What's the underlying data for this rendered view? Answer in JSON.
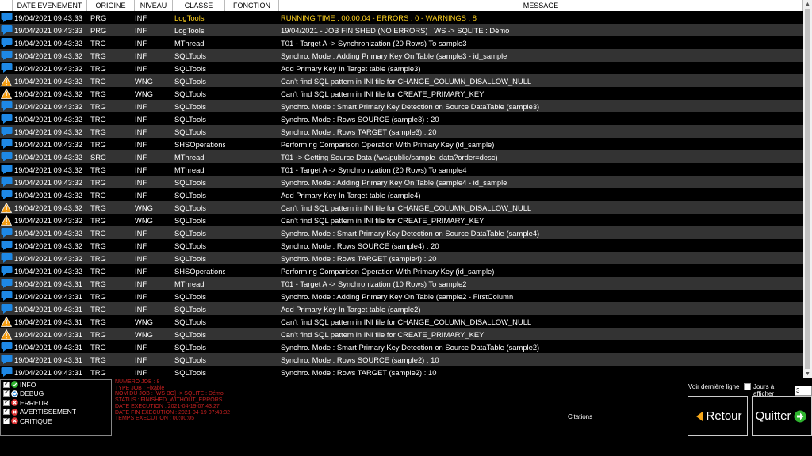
{
  "grid": {
    "columns": [
      "",
      "DATE EVENEMENT",
      "ORIGINE",
      "NIVEAU",
      "CLASSE",
      "FONCTION",
      "MESSAGE"
    ],
    "rows": [
      {
        "icon": "info-bubble-icon",
        "date": "19/04/2021 09:43:33",
        "origine": "PRG",
        "niveau": "INF",
        "classe": "LogTools",
        "fonction": "",
        "message": "RUNNING TIME : 00:00:04 - ERRORS : 0 - WARNINGS : 8",
        "highlight": true
      },
      {
        "icon": "info-bubble-icon",
        "date": "19/04/2021 09:43:33",
        "origine": "PRG",
        "niveau": "INF",
        "classe": "LogTools",
        "fonction": "",
        "message": "19/04/2021 - JOB FINISHED (NO ERRORS) : WS -> SQLITE : Démo"
      },
      {
        "icon": "info-bubble-icon",
        "date": "19/04/2021 09:43:32",
        "origine": "TRG",
        "niveau": "INF",
        "classe": "MThread",
        "fonction": "",
        "message": "T01 - Target A -> Synchronization (20 Rows) To sample3"
      },
      {
        "icon": "info-bubble-icon",
        "date": "19/04/2021 09:43:32",
        "origine": "TRG",
        "niveau": "INF",
        "classe": "SQLTools",
        "fonction": "",
        "message": "Synchro. Mode : Adding Primary Key On Table (sample3 - id_sample"
      },
      {
        "icon": "info-bubble-icon",
        "date": "19/04/2021 09:43:32",
        "origine": "TRG",
        "niveau": "INF",
        "classe": "SQLTools",
        "fonction": "",
        "message": "Add Primary Key In Target table (sample3)"
      },
      {
        "icon": "warning-icon",
        "date": "19/04/2021 09:43:32",
        "origine": "TRG",
        "niveau": "WNG",
        "classe": "SQLTools",
        "fonction": "",
        "message": "Can't find SQL pattern in INI file for CHANGE_COLUMN_DISALLOW_NULL"
      },
      {
        "icon": "warning-icon",
        "date": "19/04/2021 09:43:32",
        "origine": "TRG",
        "niveau": "WNG",
        "classe": "SQLTools",
        "fonction": "",
        "message": "Can't find SQL pattern in INI file for CREATE_PRIMARY_KEY"
      },
      {
        "icon": "info-bubble-icon",
        "date": "19/04/2021 09:43:32",
        "origine": "TRG",
        "niveau": "INF",
        "classe": "SQLTools",
        "fonction": "",
        "message": "Synchro. Mode : Smart Primary Key Detection on Source DataTable  (sample3)"
      },
      {
        "icon": "info-bubble-icon",
        "date": "19/04/2021 09:43:32",
        "origine": "TRG",
        "niveau": "INF",
        "classe": "SQLTools",
        "fonction": "",
        "message": "Synchro. Mode : Rows SOURCE  (sample3) : 20"
      },
      {
        "icon": "info-bubble-icon",
        "date": "19/04/2021 09:43:32",
        "origine": "TRG",
        "niveau": "INF",
        "classe": "SQLTools",
        "fonction": "",
        "message": "Synchro. Mode : Rows TARGET  (sample3) : 20"
      },
      {
        "icon": "info-bubble-icon",
        "date": "19/04/2021 09:43:32",
        "origine": "TRG",
        "niveau": "INF",
        "classe": "SHSOperations",
        "fonction": "",
        "message": "Performing Comparison Operation With Primary Key (id_sample)"
      },
      {
        "icon": "info-bubble-icon",
        "date": "19/04/2021 09:43:32",
        "origine": "SRC",
        "niveau": "INF",
        "classe": "MThread",
        "fonction": "",
        "message": "T01 -> Getting Source Data (/ws/public/sample_data?order=desc)"
      },
      {
        "icon": "info-bubble-icon",
        "date": "19/04/2021 09:43:32",
        "origine": "TRG",
        "niveau": "INF",
        "classe": "MThread",
        "fonction": "",
        "message": "T01 - Target A -> Synchronization (20 Rows) To sample4"
      },
      {
        "icon": "info-bubble-icon",
        "date": "19/04/2021 09:43:32",
        "origine": "TRG",
        "niveau": "INF",
        "classe": "SQLTools",
        "fonction": "",
        "message": "Synchro. Mode : Adding Primary Key On Table (sample4 - id_sample"
      },
      {
        "icon": "info-bubble-icon",
        "date": "19/04/2021 09:43:32",
        "origine": "TRG",
        "niveau": "INF",
        "classe": "SQLTools",
        "fonction": "",
        "message": "Add Primary Key In Target table (sample4)"
      },
      {
        "icon": "warning-icon",
        "date": "19/04/2021 09:43:32",
        "origine": "TRG",
        "niveau": "WNG",
        "classe": "SQLTools",
        "fonction": "",
        "message": "Can't find SQL pattern in INI file for CHANGE_COLUMN_DISALLOW_NULL"
      },
      {
        "icon": "warning-icon",
        "date": "19/04/2021 09:43:32",
        "origine": "TRG",
        "niveau": "WNG",
        "classe": "SQLTools",
        "fonction": "",
        "message": "Can't find SQL pattern in INI file for CREATE_PRIMARY_KEY"
      },
      {
        "icon": "info-bubble-icon",
        "date": "19/04/2021 09:43:32",
        "origine": "TRG",
        "niveau": "INF",
        "classe": "SQLTools",
        "fonction": "",
        "message": "Synchro. Mode : Smart Primary Key Detection on Source DataTable  (sample4)"
      },
      {
        "icon": "info-bubble-icon",
        "date": "19/04/2021 09:43:32",
        "origine": "TRG",
        "niveau": "INF",
        "classe": "SQLTools",
        "fonction": "",
        "message": "Synchro. Mode : Rows SOURCE  (sample4) : 20"
      },
      {
        "icon": "info-bubble-icon",
        "date": "19/04/2021 09:43:32",
        "origine": "TRG",
        "niveau": "INF",
        "classe": "SQLTools",
        "fonction": "",
        "message": "Synchro. Mode : Rows TARGET  (sample4) : 20"
      },
      {
        "icon": "info-bubble-icon",
        "date": "19/04/2021 09:43:32",
        "origine": "TRG",
        "niveau": "INF",
        "classe": "SHSOperations",
        "fonction": "",
        "message": "Performing Comparison Operation With Primary Key (id_sample)"
      },
      {
        "icon": "info-bubble-icon",
        "date": "19/04/2021 09:43:31",
        "origine": "TRG",
        "niveau": "INF",
        "classe": "MThread",
        "fonction": "",
        "message": "T01 - Target A -> Synchronization (10 Rows) To sample2"
      },
      {
        "icon": "info-bubble-icon",
        "date": "19/04/2021 09:43:31",
        "origine": "TRG",
        "niveau": "INF",
        "classe": "SQLTools",
        "fonction": "",
        "message": "Synchro. Mode : Adding Primary Key On Table (sample2 - FirstColumn"
      },
      {
        "icon": "info-bubble-icon",
        "date": "19/04/2021 09:43:31",
        "origine": "TRG",
        "niveau": "INF",
        "classe": "SQLTools",
        "fonction": "",
        "message": "Add Primary Key In Target table (sample2)"
      },
      {
        "icon": "warning-icon",
        "date": "19/04/2021 09:43:31",
        "origine": "TRG",
        "niveau": "WNG",
        "classe": "SQLTools",
        "fonction": "",
        "message": "Can't find SQL pattern in INI file for CHANGE_COLUMN_DISALLOW_NULL"
      },
      {
        "icon": "warning-icon",
        "date": "19/04/2021 09:43:31",
        "origine": "TRG",
        "niveau": "WNG",
        "classe": "SQLTools",
        "fonction": "",
        "message": "Can't find SQL pattern in INI file for CREATE_PRIMARY_KEY"
      },
      {
        "icon": "info-bubble-icon",
        "date": "19/04/2021 09:43:31",
        "origine": "TRG",
        "niveau": "INF",
        "classe": "SQLTools",
        "fonction": "",
        "message": "Synchro. Mode : Smart Primary Key Detection on Source DataTable  (sample2)"
      },
      {
        "icon": "info-bubble-icon",
        "date": "19/04/2021 09:43:31",
        "origine": "TRG",
        "niveau": "INF",
        "classe": "SQLTools",
        "fonction": "",
        "message": "Synchro. Mode : Rows SOURCE  (sample2) : 10"
      },
      {
        "icon": "info-bubble-icon",
        "date": "19/04/2021 09:43:31",
        "origine": "TRG",
        "niveau": "INF",
        "classe": "SQLTools",
        "fonction": "",
        "message": "Synchro. Mode : Rows TARGET  (sample2) : 10"
      }
    ]
  },
  "filters": [
    {
      "label": "INFO",
      "icon": "check-circle-icon",
      "checked": true,
      "color": "#2fb52f"
    },
    {
      "label": "DEBUG",
      "icon": "refresh-icon",
      "checked": true,
      "color": "#2a8be0"
    },
    {
      "label": "ERREUR",
      "icon": "error-icon",
      "checked": true,
      "color": "#e03030"
    },
    {
      "label": "AVERTISSEMENT",
      "icon": "error-icon",
      "checked": true,
      "color": "#e03030"
    },
    {
      "label": "CRITIQUE",
      "icon": "error-icon",
      "checked": true,
      "color": "#e03030"
    }
  ],
  "job_info": [
    "NUMERO JOB : 8",
    "TYPE JOB : Fixable",
    "NOM DU JOB : [WS BO] -> SQLITE : Démo",
    "STATUS : FINISHED_WITHOUT_ERRORS",
    "DATE EXECUTION : 2021-04-19 07:43:27",
    "DATE FIN EXECUTION : 2021-04-19 07:43:32",
    "TEMPS EXECUTION : 00:00:05"
  ],
  "footer": {
    "citations": "Citations",
    "last_line_label": "Voir dernière ligne",
    "days_label": "Jours à afficher",
    "days_value": "3",
    "retour_label": "Retour",
    "quitter_label": "Quitter"
  },
  "colors": {
    "highlight": "#ffd21f",
    "info_icon": "#1e88e5",
    "warning_icon": "#f39c12",
    "job_info_text": "#c62020"
  }
}
